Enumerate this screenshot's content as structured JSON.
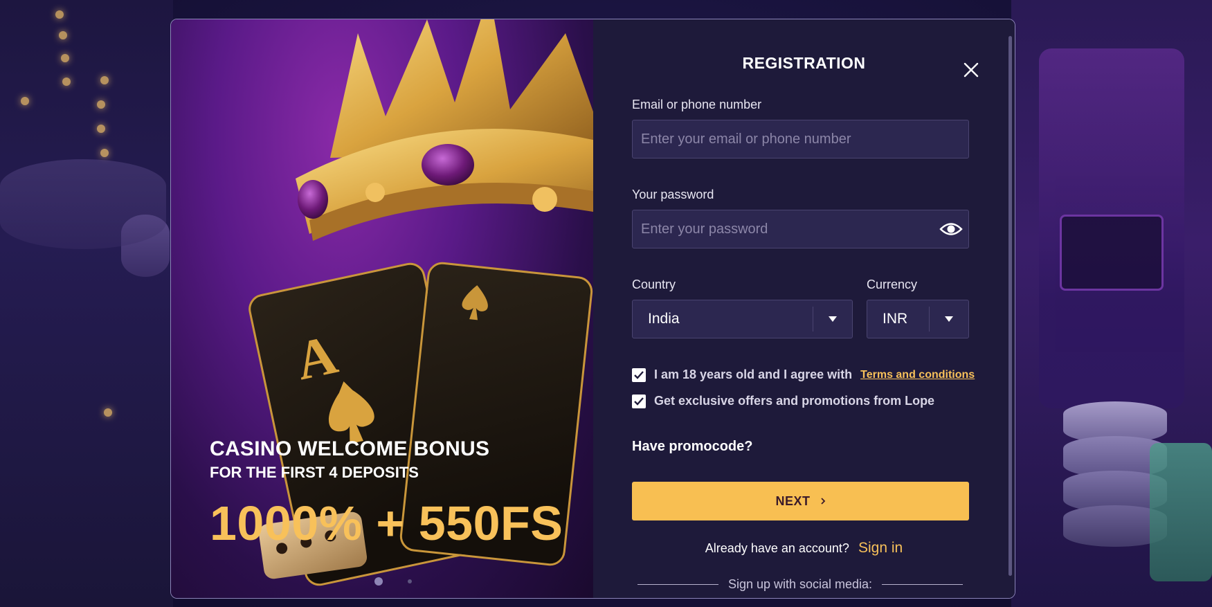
{
  "promo": {
    "title": "CASINO WELCOME BONUS",
    "subtitle": "FOR THE FIRST 4 DEPOSITS",
    "amount": "1000% + 550FS",
    "active_slide": 1,
    "slide_count": 2
  },
  "form": {
    "title": "REGISTRATION",
    "email": {
      "label": "Email or phone number",
      "placeholder": "Enter your email or phone number",
      "value": ""
    },
    "password": {
      "label": "Your password",
      "placeholder": "Enter your password",
      "value": ""
    },
    "country": {
      "label": "Country",
      "selected": "India"
    },
    "currency": {
      "label": "Currency",
      "selected": "INR"
    },
    "age_agree": {
      "checked": true,
      "text": "I am 18 years old and I agree with",
      "link": "Terms and conditions"
    },
    "offers": {
      "checked": true,
      "text": "Get exclusive offers and promotions from Lope"
    },
    "promocode_label": "Have promocode?",
    "next_label": "NEXT",
    "signin_question": "Already have an account?",
    "signin_link": "Sign in",
    "social_label": "Sign up with social media:"
  },
  "colors": {
    "accent": "#f8bf52",
    "panel": "#1e1a3a",
    "input_bg": "#2c2750"
  },
  "icons": {
    "close": "close-icon",
    "eye": "eye-icon",
    "dropdown": "caret-down-icon",
    "check": "checkmark-icon",
    "next": "chevron-right-icon",
    "google": "google-icon"
  }
}
